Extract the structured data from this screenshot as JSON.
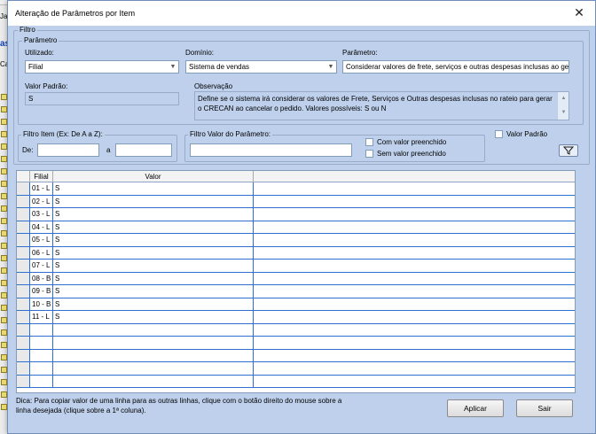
{
  "background": {
    "fragments": [
      "Ja",
      "as",
      "Ca"
    ]
  },
  "dialog": {
    "title": "Alteração de Parâmetros por Item",
    "close_glyph": "✕"
  },
  "filtro": {
    "group_label": "Filtro",
    "parametro_group_label": "Parâmetro",
    "utilizado": {
      "label": "Utilizado:",
      "value": "Filial"
    },
    "dominio": {
      "label": "Domínio:",
      "value": "Sistema de vendas"
    },
    "parametro": {
      "label": "Parâmetro:",
      "value": "Considerar valores de frete, serviços e outras despesas inclusas ao ger"
    },
    "valor_padrao": {
      "label": "Valor Padrão:",
      "value": "S"
    },
    "observacao": {
      "label": "Observação",
      "text": "Define se o sistema irá considerar os valores de Frete, Serviços e Outras despesas inclusas no rateio para gerar o CRECAN ao cancelar o pedido. Valores possíveis: S ou N"
    }
  },
  "filtro_item": {
    "label": "Filtro Item (Ex: De A a Z):",
    "de_label": "De:",
    "a_label": "a",
    "de_value": "",
    "a_value": ""
  },
  "filtro_valor": {
    "label": "Filtro Valor do Parâmetro:",
    "value": "",
    "com_valor": "Com valor preenchido",
    "sem_valor": "Sem valor preenchido"
  },
  "valor_padrao_check": {
    "label": "Valor Padrão",
    "checked": false
  },
  "grid": {
    "columns": [
      "Filial",
      "Valor"
    ],
    "rows": [
      {
        "filial": "01 - L",
        "valor": "S"
      },
      {
        "filial": "02 - L",
        "valor": "S"
      },
      {
        "filial": "03 - L",
        "valor": "S"
      },
      {
        "filial": "04 - L",
        "valor": "S"
      },
      {
        "filial": "05 - L",
        "valor": "S"
      },
      {
        "filial": "06 - L",
        "valor": "S"
      },
      {
        "filial": "07 - L",
        "valor": "S"
      },
      {
        "filial": "08 - B",
        "valor": "S"
      },
      {
        "filial": "09 - B",
        "valor": "S"
      },
      {
        "filial": "10 - B",
        "valor": "S"
      },
      {
        "filial": "11 - L",
        "valor": "S"
      },
      {
        "filial": "",
        "valor": ""
      },
      {
        "filial": "",
        "valor": ""
      },
      {
        "filial": "",
        "valor": ""
      },
      {
        "filial": "",
        "valor": ""
      },
      {
        "filial": "",
        "valor": ""
      }
    ]
  },
  "footer": {
    "tip": "Dica: Para copiar valor de uma linha para as outras linhas, clique com o botão direito do mouse sobre a linha desejada (clique sobre a 1ª coluna).",
    "aplicar": "Aplicar",
    "sair": "Sair"
  },
  "colors": {
    "client_bg": "#bed0ec",
    "grid_line": "#2f6fd0"
  }
}
